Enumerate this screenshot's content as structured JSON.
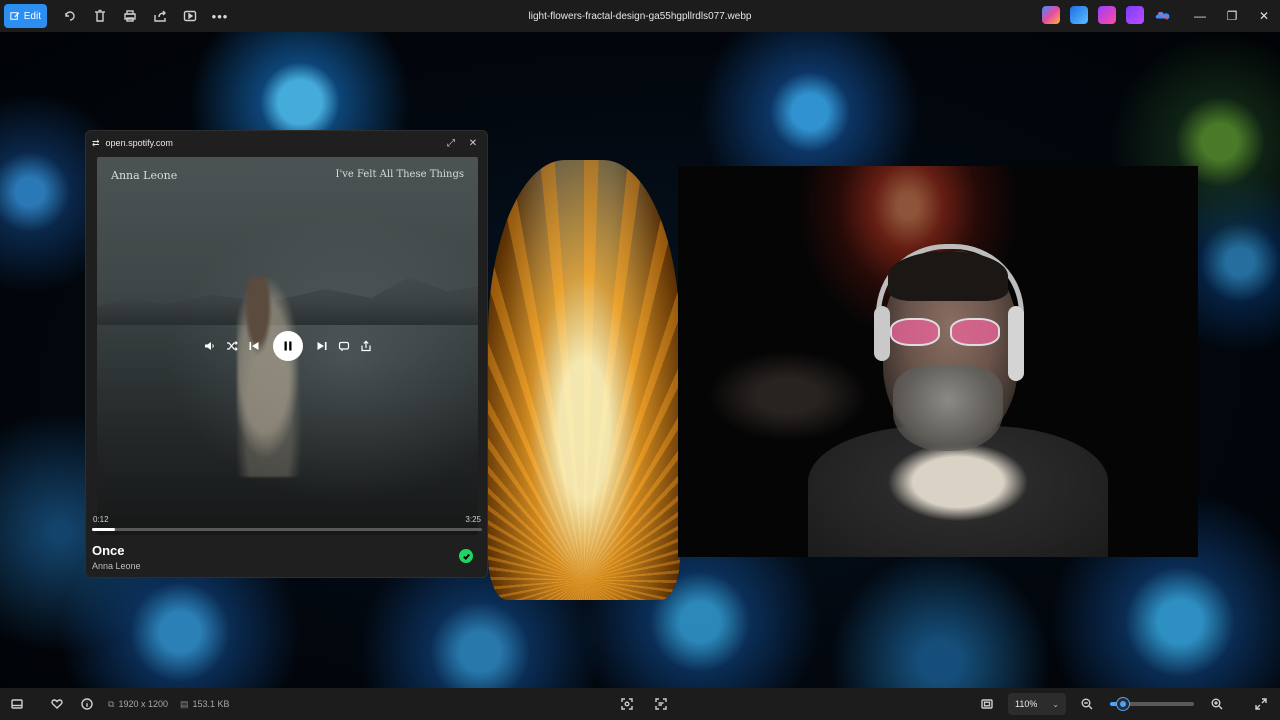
{
  "window": {
    "file_name": "light-flowers-fractal-design-ga55hgpllrdls077.webp",
    "edit_label": "Edit"
  },
  "toolbar": {
    "icons": [
      "rotate-icon",
      "delete-icon",
      "print-icon",
      "share-icon",
      "slideshow-icon",
      "more-icon"
    ],
    "app_icons": [
      "copilot-icon",
      "designer-icon",
      "clipchamp-icon",
      "create-icon",
      "onedrive-icon"
    ]
  },
  "player": {
    "url": "open.spotify.com",
    "art_artist": "Anna Leone",
    "art_album": "I've Felt All These Things",
    "elapsed": "0:12",
    "duration": "3:25",
    "progress": 0.06,
    "track_title": "Once",
    "track_artist": "Anna Leone",
    "saved": true,
    "accent": "#1ed760"
  },
  "status": {
    "dimensions": "1920 x 1200",
    "file_size": "153.1 KB",
    "zoom": "110%",
    "zoom_level": 0.15,
    "accent": "#4aa3ff"
  }
}
